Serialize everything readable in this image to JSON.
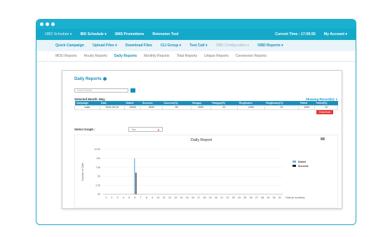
{
  "nav_main": {
    "items": [
      {
        "label": "OBD Schedule ▾",
        "dim": true
      },
      {
        "label": "IBD Schedule ▾",
        "dim": false
      },
      {
        "label": "SMS Promotions",
        "dim": false
      },
      {
        "label": "Retension Tool",
        "dim": false
      }
    ],
    "current_time": "Current Time : 17:59:55",
    "account": "My Account ▾"
  },
  "nav_sub": {
    "items": [
      {
        "label": "Quick Campaign",
        "dim": false
      },
      {
        "label": "Upload Files ▾",
        "dim": false
      },
      {
        "label": "Download Files",
        "dim": false
      },
      {
        "label": "CLI Group ▾",
        "dim": false
      },
      {
        "label": "Test Call ▾",
        "dim": false
      },
      {
        "label": "OBD Configuration ▾",
        "dim": true
      },
      {
        "label": "OBD Reports ▾",
        "dim": false
      }
    ]
  },
  "nav_reports": {
    "items": [
      {
        "label": "MOU Reports",
        "active": false
      },
      {
        "label": "Hourly Reports",
        "active": false
      },
      {
        "label": "Daily Reports",
        "active": true
      },
      {
        "label": "Monthly Reports",
        "active": false
      },
      {
        "label": "Total Reports",
        "active": false
      },
      {
        "label": "Unique Reports",
        "active": false
      },
      {
        "label": "Conversion Reports",
        "active": false
      }
    ]
  },
  "panel": {
    "title": "Daily Reports",
    "search_placeholder": "Select Month",
    "selected_month": "Selected Month: May",
    "showing_records": "Showing Record(s): 1",
    "download_label": "Download",
    "select_graph_label": "Select Graph :",
    "select_graph_value": "Bar"
  },
  "table": {
    "headers": [
      "Campaign",
      "Date",
      "Dialed",
      "Success",
      "Success(%)",
      "Hangup",
      "Hangup(%)",
      "RingNoans",
      "RingNoans(%)",
      "Failed",
      "Failed(%)"
    ],
    "rows": [
      [
        "maid",
        "2015-05-16",
        "10000",
        "6000",
        "60",
        "2000",
        "20",
        "1000",
        "10",
        "1000",
        "10"
      ]
    ]
  },
  "chart_data": {
    "type": "bar",
    "title": "Daily Report",
    "ylabel": "Number of Calls",
    "xlabel": "Date (in numbers)",
    "ylim": [
      0,
      12500
    ],
    "yticks": [
      "0k",
      "2.5k",
      "5k",
      "7.5k",
      "10k",
      "12.5k"
    ],
    "categories": [
      "1",
      "2",
      "3",
      "4",
      "5",
      "6",
      "7",
      "8",
      "9",
      "10",
      "11",
      "12",
      "13",
      "14",
      "15",
      "16",
      "17",
      "18",
      "19",
      "20",
      "21",
      "22",
      "23",
      "24",
      "25",
      "26",
      "27",
      "28",
      "29",
      "30",
      "31"
    ],
    "series": [
      {
        "name": "Dialed",
        "color": "#6db6e6",
        "values": [
          0,
          0,
          0,
          0,
          0,
          10000,
          0,
          0,
          0,
          0,
          0,
          0,
          0,
          0,
          0,
          0,
          0,
          0,
          0,
          0,
          0,
          0,
          0,
          0,
          0,
          0,
          0,
          0,
          0,
          0,
          0
        ]
      },
      {
        "name": "Success",
        "color": "#222222",
        "values": [
          0,
          0,
          0,
          0,
          0,
          6000,
          0,
          0,
          0,
          0,
          0,
          0,
          0,
          0,
          0,
          0,
          0,
          0,
          0,
          0,
          0,
          0,
          0,
          0,
          0,
          0,
          0,
          0,
          0,
          0,
          0
        ]
      }
    ],
    "legend": "right",
    "grid": true
  },
  "colors": {
    "accent": "#1ab0cf",
    "link": "#1a8fbd",
    "danger": "#e23b3b"
  }
}
